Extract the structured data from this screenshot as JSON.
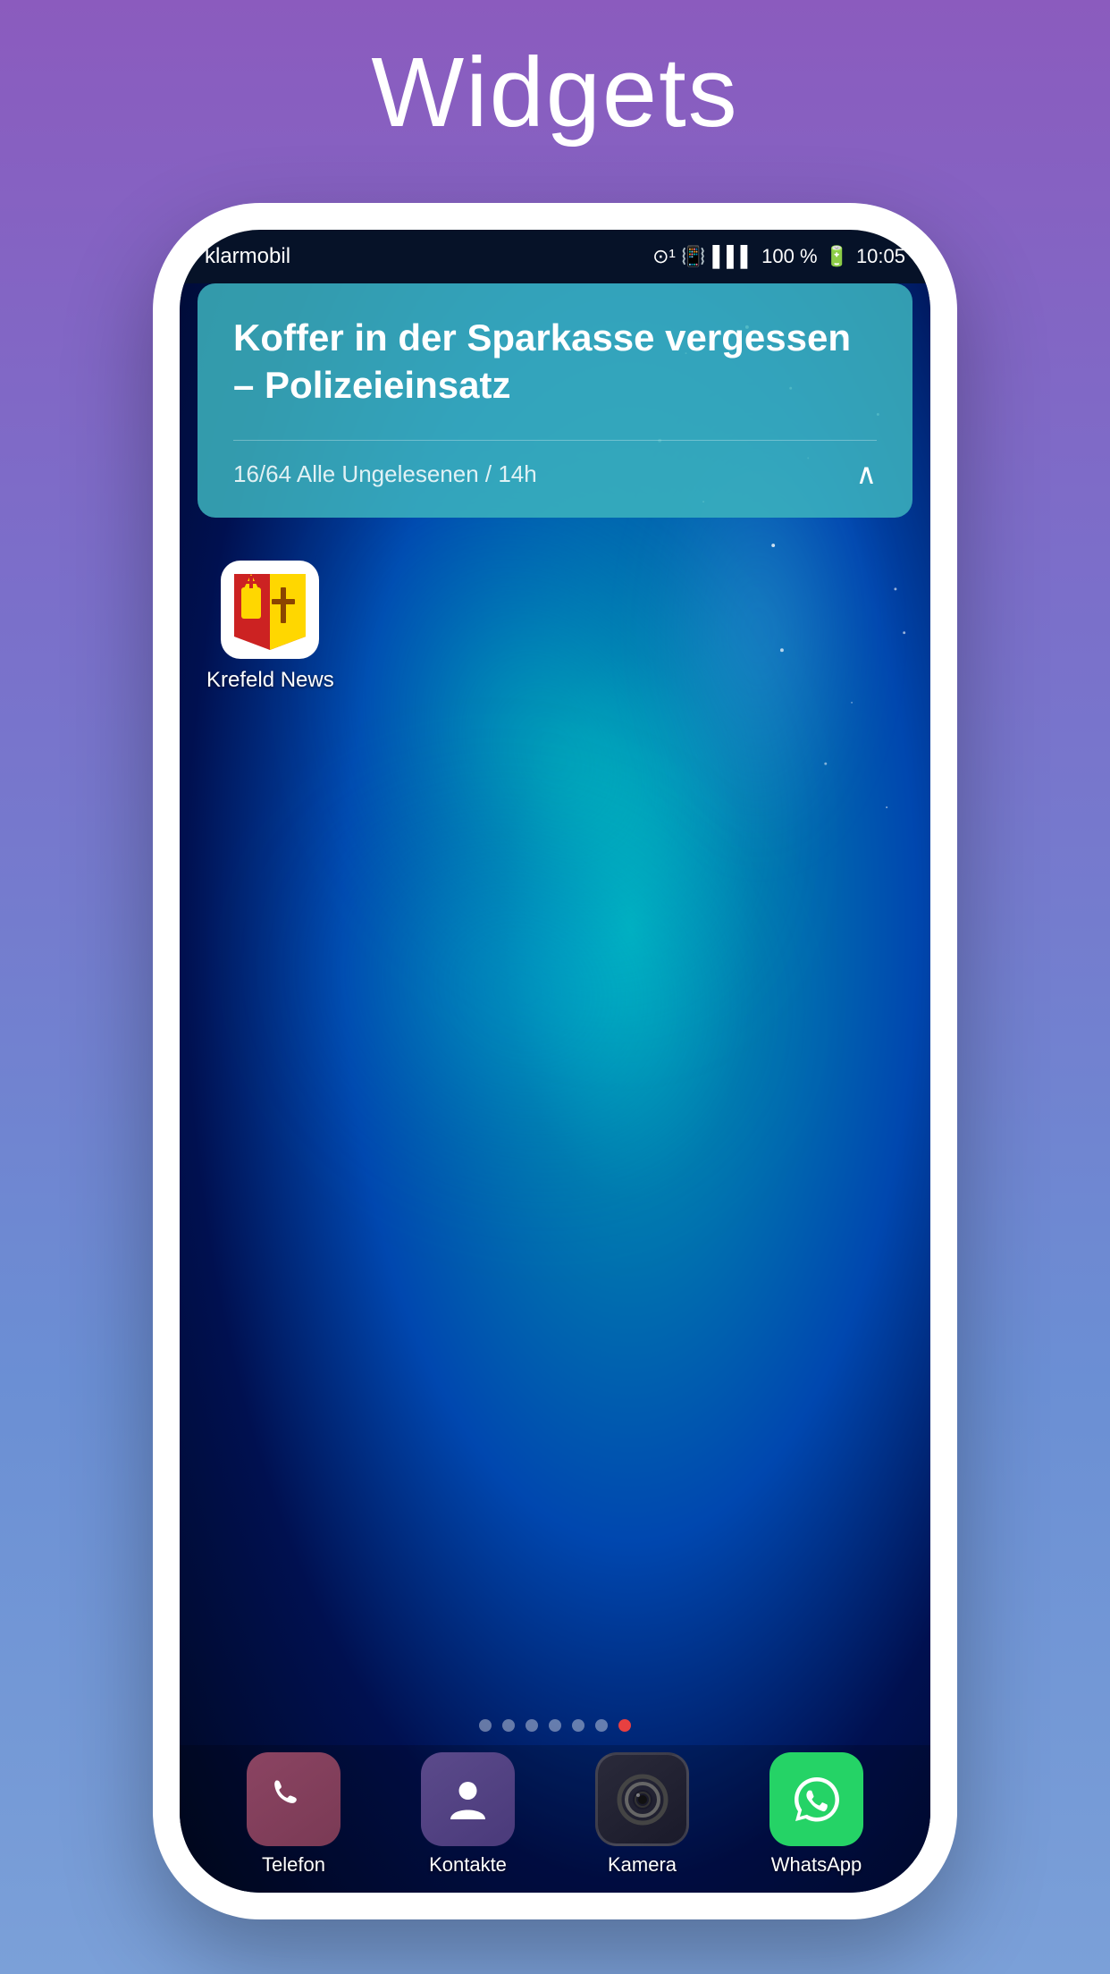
{
  "page": {
    "title": "Widgets",
    "background_gradient": "purple-to-blue"
  },
  "status_bar": {
    "carrier": "klarmobil",
    "battery_percent": "100 %",
    "time": "10:05"
  },
  "widget": {
    "headline": "Koffer in der Sparkasse vergessen – Polizeieinsatz",
    "meta": "16/64  Alle Ungelesenen / 14h"
  },
  "krefeld_icon": {
    "label": "Krefeld News"
  },
  "page_dots": {
    "count": 7,
    "active_index": 6
  },
  "dock": {
    "items": [
      {
        "id": "telefon",
        "label": "Telefon"
      },
      {
        "id": "kontakte",
        "label": "Kontakte"
      },
      {
        "id": "kamera",
        "label": "Kamera"
      },
      {
        "id": "whatsapp",
        "label": "WhatsApp"
      }
    ]
  }
}
